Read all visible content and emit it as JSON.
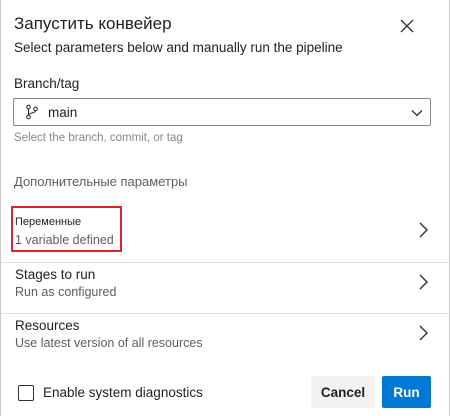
{
  "dialog": {
    "title": "Запустить конвейер",
    "subtitle": "Select parameters below and manually run the pipeline"
  },
  "branch": {
    "label": "Branch/tag",
    "value": "main",
    "hint": "Select the branch, commit, or tag",
    "icon": "git-branch-icon"
  },
  "advanced": {
    "heading": "Дополнительные  параметры",
    "rows": [
      {
        "title": "Переменные",
        "subtitle": "1 variable defined"
      },
      {
        "title": "Stages to run",
        "subtitle": "Run as configured"
      },
      {
        "title": "Resources",
        "subtitle": "Use latest version of all resources"
      }
    ]
  },
  "diagnostics": {
    "label": "Enable system diagnostics",
    "checked": false
  },
  "buttons": {
    "cancel": "Cancel",
    "run": "Run"
  },
  "colors": {
    "primary": "#0078d4",
    "highlight": "#e0242a"
  }
}
